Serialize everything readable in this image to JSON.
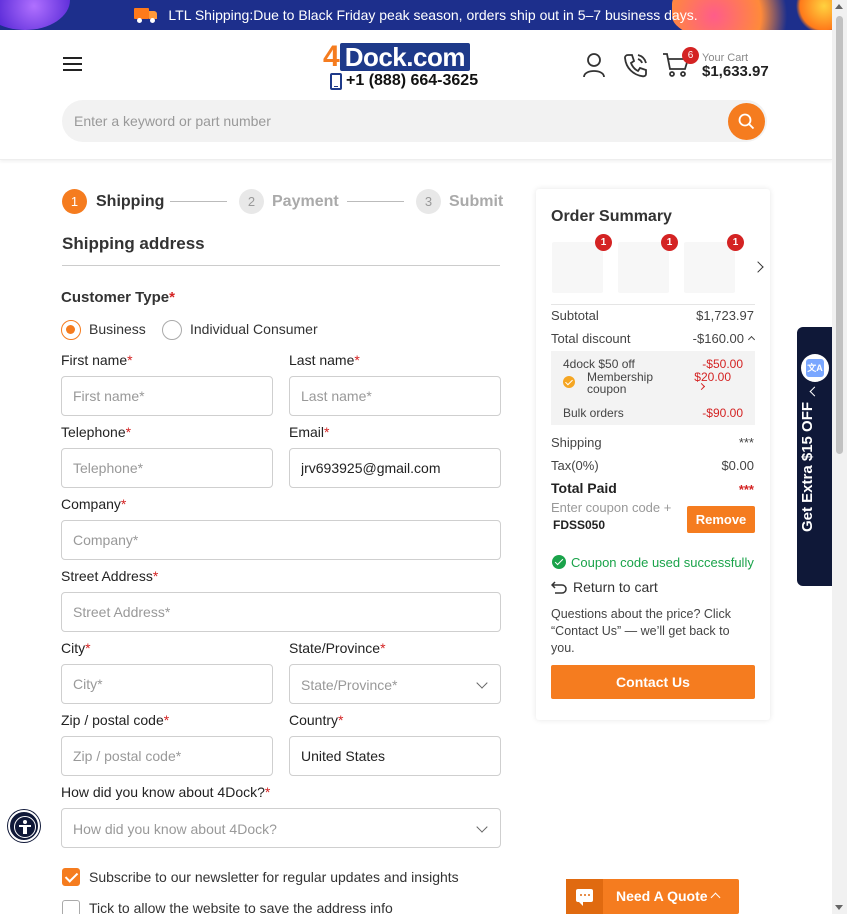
{
  "banner": {
    "text": "LTL Shipping:Due to Black Friday peak season, orders ship out in 5–7 business days."
  },
  "header": {
    "logo_prefix": "4",
    "logo_rest": "Dock.com",
    "phone": "+1 (888) 664-3625",
    "cart_count": "6",
    "cart_label": "Your Cart",
    "cart_total": "$1,633.97"
  },
  "search": {
    "placeholder": "Enter a keyword or part number"
  },
  "steps": [
    {
      "num": "1",
      "label": "Shipping"
    },
    {
      "num": "2",
      "label": "Payment"
    },
    {
      "num": "3",
      "label": "Submit"
    }
  ],
  "form": {
    "section_title": "Shipping address",
    "customer_type_label": "Customer Type",
    "customer_type_options": [
      "Business",
      "Individual Consumer"
    ],
    "customer_type_selected": "Business",
    "first_name_label": "First name",
    "first_name_placeholder": "First name*",
    "last_name_label": "Last name",
    "last_name_placeholder": "Last name*",
    "telephone_label": "Telephone",
    "telephone_placeholder": "Telephone*",
    "email_label": "Email",
    "email_value": "jrv693925@gmail.com",
    "company_label": "Company",
    "company_placeholder": "Company*",
    "street_label": "Street Address",
    "street_placeholder": "Street Address*",
    "city_label": "City",
    "city_placeholder": "City*",
    "state_label": "State/Province",
    "state_placeholder": "State/Province*",
    "zip_label": "Zip / postal code",
    "zip_placeholder": "Zip / postal code*",
    "country_label": "Country",
    "country_value": "United States",
    "source_label": "How did you know about 4Dock?",
    "source_placeholder": "How did you know about 4Dock?",
    "required_mark": "*",
    "newsletter_label": "Subscribe to our newsletter for regular updates and insights",
    "newsletter_checked": true,
    "save_address_label": "Tick to allow the website to save the address info",
    "save_address_checked": false
  },
  "summary": {
    "title": "Order Summary",
    "thumb_badges": [
      "1",
      "1",
      "1"
    ],
    "subtotal_label": "Subtotal",
    "subtotal_value": "$1,723.97",
    "discount_label": "Total discount",
    "discount_value": "-$160.00",
    "discounts": [
      {
        "label": "4dock $50 off",
        "value": "-$50.00"
      },
      {
        "label": "Membership coupon",
        "value": "$20.00"
      },
      {
        "label": "Bulk orders",
        "value": "-$90.00"
      }
    ],
    "shipping_label": "Shipping",
    "shipping_value": "***",
    "tax_label": "Tax(0%)",
    "tax_value": "$0.00",
    "total_label": "Total Paid",
    "total_value": "***",
    "coupon_placeholder": "Enter coupon code +",
    "coupon_value": "FDSS050",
    "remove_label": "Remove",
    "success_text": "Coupon code used successfully",
    "return_label": "Return to cart",
    "question_text": "Questions about the price? Click “Contact Us” — we’ll get back to you.",
    "contact_label": "Contact Us"
  },
  "side_tab": {
    "text": "Get Extra $15 OFF",
    "translate_icon_text": "文A"
  },
  "quote": {
    "label": "Need A Quote"
  },
  "colors": {
    "accent": "#f57c1f",
    "brand_blue": "#1e3a8a",
    "alert_red": "#d42323",
    "success_green": "#1aa34a"
  }
}
